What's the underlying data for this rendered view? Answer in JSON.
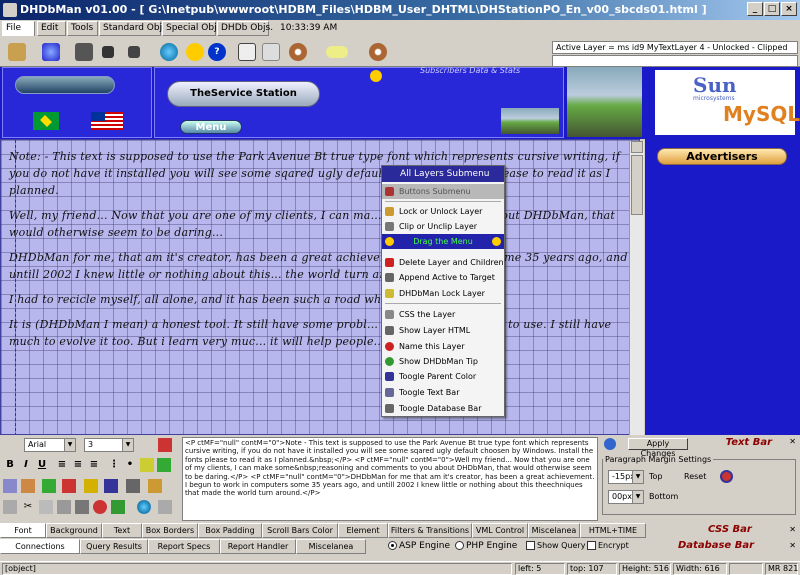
{
  "window": {
    "title": "DHDbMan v01.00 - [ G:\\Inetpub\\wwwroot\\HDBM_Files\\HDBM_User_DHTML\\DHStationPO_En_v00_sbcds01.html ]"
  },
  "tabs": [
    "File",
    "Edit",
    "Tools",
    "Standard Objs.",
    "Special Objs.",
    "DHDb Objs."
  ],
  "clock": "10:33:39 AM",
  "active_layer": "Active Layer = ms   id9  MyTextLayer  4 - Unlocked - Clipped",
  "banner": {
    "station_label": "TheService Station",
    "menu_label": "Menu",
    "ticker": "Subscribers Data & Stats",
    "advertisers": "Advertisers",
    "sun_text": "Sun",
    "sun_sub": "microsystems",
    "mysql_text": "MySQL"
  },
  "content": {
    "paragraphs": [
      "Note: - This text is supposed to use the Park Avenue Bt true type font which represents cursive writing, if you do not have it installed you will see some sqared ugly default ch... all the fonts please to read it as I planned.",
      "Well, my friend... Now that you are one of my clients, I can ma... comments to you about DHDbMan, that would otherwise seem to be daring...",
      "DHDbMan for me, that am it's creator, has been a great achieveme... in computers some 35 years ago, and untill 2002 I knew little or nothing about this... the world turn around.",
      "I had to recicle myself, all alone, and it has been such a road wh... I did it.",
      "It is (DHDbMan I mean) a honest tool. It still have some probl... can be made simpler, to use. I still have much to evolve it too. But i learn very muc... it will help people..."
    ]
  },
  "context_menu": {
    "header": "All Layers Submenu",
    "items": [
      "Buttons Submenu",
      "Lock or Unlock Layer",
      "Clip or Unclip Layer",
      "Drag the Menu",
      "Delete Layer and Children",
      "Append Active to Target",
      "DHDbMan Lock Layer",
      "CSS the Layer",
      "Show Layer HTML",
      "Name this Layer",
      "Show DHDbMan Tip",
      "Toogle Parent Color",
      "Toogle Text Bar",
      "Toogle Database Bar"
    ]
  },
  "font_bar": {
    "font": "Arial",
    "size": "3"
  },
  "code_text": "<P ctMF=\"null\" contM=\"0\">Note - This text is supposed to use the Park Avenue Bt true type font which represents cursive writing, if you do not have it installed you will see some sqared ugly default choosen by Windows. Install the fonts please to read it as I planned.&nbsp;</P>\n<P ctMF=\"null\" contM=\"0\">Well my friend... Now that you are one of my clients, I can make some&nbsp;reasoning and comments to you about DHDbMan, that would otherwise seem to be daring.</P>\n<P ctMF=\"null\" contM=\"0\">DHDbMan for me that am it's creator, has been a great achievement. I begun to work in computers some 35 years ago, and untill 2002 I knew little or nothing about this theechniques that made the world turn around.</P>",
  "text_bar": {
    "apply": "Apply Changes",
    "label": "Text Bar",
    "fieldset": "Paragraph Margin Settings",
    "top_val": "-15px",
    "top_label": "Top",
    "reset": "Reset",
    "bottom_val": "00px",
    "bottom_label": "Bottom"
  },
  "css_tabs": [
    "Font",
    "Background",
    "Text",
    "Box Borders",
    "Box Padding",
    "Scroll Bars Color",
    "Element",
    "Filters & Transitions",
    "VML Control",
    "Miscelanea",
    "HTML+TIME"
  ],
  "css_bar_label": "CSS Bar",
  "db_tabs": [
    "Connections",
    "Query Results",
    "Report Specs",
    "Report Handler",
    "Miscelanea"
  ],
  "db": {
    "asp": "ASP Engine",
    "php": "PHP Engine",
    "show_query": "Show Query",
    "encrypt": "Encrypt",
    "label": "Database Bar"
  },
  "status": {
    "object": "[object]",
    "left_label": "left:",
    "left": "5",
    "top_label": "top:",
    "top": "107",
    "height_label": "Height:",
    "height": "516",
    "width_label": "Width:",
    "width": "616",
    "mr_label": "MR",
    "mr": "821"
  }
}
